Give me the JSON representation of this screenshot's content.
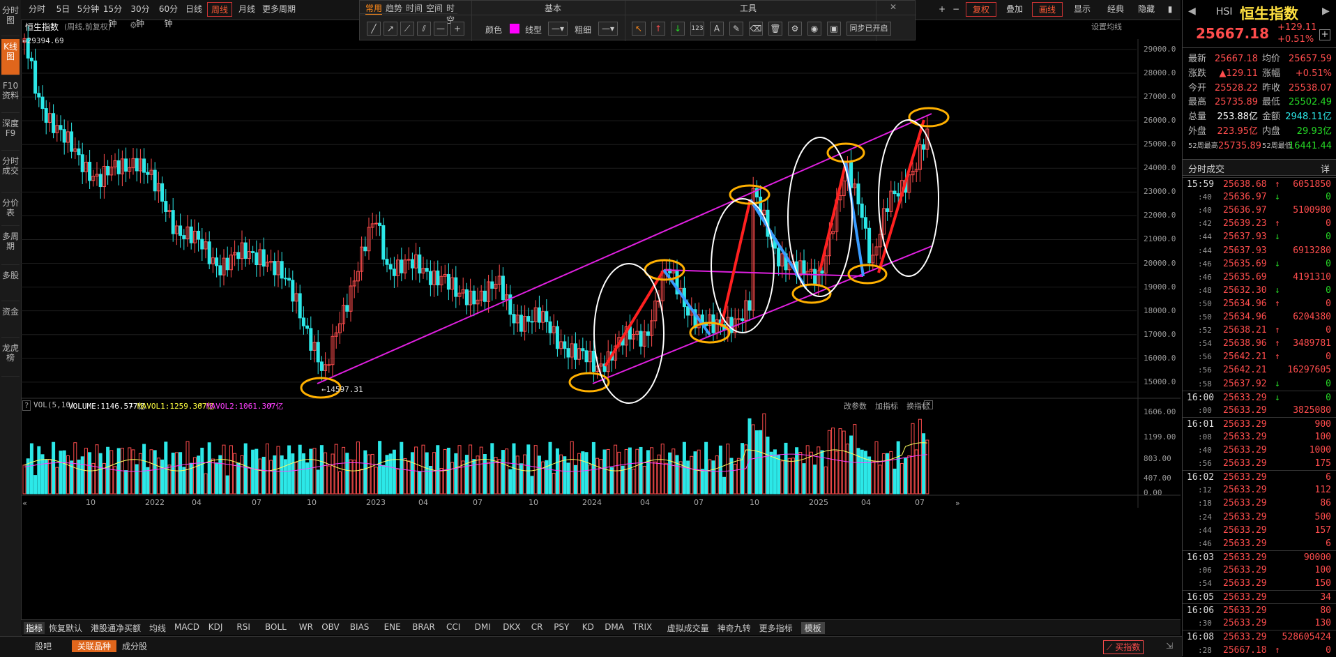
{
  "left_nav": [
    "分时图",
    "K线图",
    "F10资料",
    "深度F9",
    "分时成交",
    "分价表",
    "多周期",
    "多股",
    "资金",
    "龙虎榜"
  ],
  "toolbar": {
    "periods": [
      "分时",
      "5日",
      "5分钟",
      "15分钟",
      "30分钟",
      "60分钟",
      "日线",
      "周线",
      "月线",
      "更多周期"
    ],
    "selected_period": "周线",
    "right_buttons": [
      "复权",
      "叠加",
      "画线",
      "显示",
      "经典",
      "隐藏"
    ]
  },
  "draw_panel": {
    "tabs": [
      "常用",
      "趋势",
      "时间",
      "空间",
      "时空"
    ],
    "section_basic": "基本",
    "section_tools": "工具",
    "color_label": "颜色",
    "line_type_label": "线型",
    "thickness_label": "粗细",
    "sync_label": "同步已开启"
  },
  "chart_header": {
    "name": "恒生指数",
    "mode": "(周线,前复权)",
    "settings": "设置均线"
  },
  "price_axis": [
    "29000.0",
    "28000.0",
    "27000.0",
    "26000.0",
    "25000.0",
    "24000.0",
    "23000.0",
    "22000.0",
    "21000.0",
    "20000.0",
    "19000.0",
    "18000.0",
    "17000.0",
    "16000.0",
    "15000.0"
  ],
  "annotations": {
    "high": "29394.69",
    "low": "14597.31"
  },
  "volume_header": {
    "label": "VOL(5,10)",
    "volume": "VOLUME:1146.577亿",
    "ma1": "MAVOL1:1259.367亿",
    "ma2": "MAVOL2:1061.307亿",
    "actions": [
      "改参数",
      "加指标",
      "换指标"
    ]
  },
  "volume_axis": [
    "1606.00",
    "1199.00",
    "803.00",
    "407.00",
    "0.00"
  ],
  "time_axis": [
    "10",
    "2022",
    "04",
    "07",
    "10",
    "2023",
    "04",
    "07",
    "10",
    "2024",
    "04",
    "07",
    "10",
    "2025",
    "04",
    "07"
  ],
  "indicators": [
    "指标",
    "恢复默认",
    "港股通净买额",
    "均线",
    "MACD",
    "KDJ",
    "RSI",
    "BOLL",
    "WR",
    "OBV",
    "BIAS",
    "ENE",
    "BRAR",
    "CCI",
    "DMI",
    "DKX",
    "CR",
    "PSY",
    "KD",
    "DMA",
    "TRIX",
    "虚拟成交量",
    "神奇九转",
    "更多指标",
    "模板"
  ],
  "bottom_tabs": [
    "股吧",
    "关联品种",
    "成分股"
  ],
  "buy_index": "买指数",
  "quote": {
    "code": "HSI",
    "name": "恒生指数",
    "price": "25667.18",
    "change": "+129.11",
    "change_pct": "+0.51%",
    "rows": [
      [
        "最新",
        "25667.18",
        "均价",
        "25657.59"
      ],
      [
        "涨跌",
        "▲129.11",
        "涨幅",
        "+0.51%"
      ],
      [
        "今开",
        "25528.22",
        "昨收",
        "25538.07"
      ],
      [
        "最高",
        "25735.89",
        "最低",
        "25502.49"
      ],
      [
        "总量",
        "253.88亿",
        "金额",
        "2948.11亿"
      ],
      [
        "外盘",
        "223.95亿",
        "内盘",
        "29.93亿"
      ],
      [
        "52周最高",
        "25735.89",
        "52周最低",
        "16441.44"
      ]
    ]
  },
  "trades_title": "分时成交",
  "trades_detail": "详",
  "trades": [
    [
      "15:59",
      "25638.68",
      "↑",
      "6051850"
    ],
    [
      ":40",
      "25636.97",
      "↓",
      "0"
    ],
    [
      ":40",
      "25636.97",
      "",
      "5100980"
    ],
    [
      ":42",
      "25639.23",
      "↑",
      "0"
    ],
    [
      ":44",
      "25637.93",
      "↓",
      "0"
    ],
    [
      ":44",
      "25637.93",
      "",
      "6913280"
    ],
    [
      ":46",
      "25635.69",
      "↓",
      "0"
    ],
    [
      ":46",
      "25635.69",
      "",
      "4191310"
    ],
    [
      ":48",
      "25632.30",
      "↓",
      "0"
    ],
    [
      ":50",
      "25634.96",
      "↑",
      "0"
    ],
    [
      ":50",
      "25634.96",
      "",
      "6204380"
    ],
    [
      ":52",
      "25638.21",
      "↑",
      "0"
    ],
    [
      ":54",
      "25638.96",
      "↑",
      "3489781"
    ],
    [
      ":56",
      "25642.21",
      "↑",
      "0"
    ],
    [
      ":56",
      "25642.21",
      "",
      "16297605"
    ],
    [
      ":58",
      "25637.92",
      "↓",
      "0"
    ],
    [
      "16:00",
      "25633.29",
      "↓",
      "0"
    ],
    [
      ":00",
      "25633.29",
      "",
      "3825080"
    ],
    [
      "16:01",
      "25633.29",
      "",
      "900"
    ],
    [
      ":08",
      "25633.29",
      "",
      "100"
    ],
    [
      ":40",
      "25633.29",
      "",
      "1000"
    ],
    [
      ":56",
      "25633.29",
      "",
      "175"
    ],
    [
      "16:02",
      "25633.29",
      "",
      "6"
    ],
    [
      ":12",
      "25633.29",
      "",
      "112"
    ],
    [
      ":18",
      "25633.29",
      "",
      "86"
    ],
    [
      ":24",
      "25633.29",
      "",
      "500"
    ],
    [
      ":44",
      "25633.29",
      "",
      "157"
    ],
    [
      ":46",
      "25633.29",
      "",
      "6"
    ],
    [
      "16:03",
      "25633.29",
      "",
      "90000"
    ],
    [
      ":06",
      "25633.29",
      "",
      "100"
    ],
    [
      ":54",
      "25633.29",
      "",
      "150"
    ],
    [
      "16:05",
      "25633.29",
      "",
      "34"
    ],
    [
      "16:06",
      "25633.29",
      "",
      "80"
    ],
    [
      ":30",
      "25633.29",
      "",
      "130"
    ],
    [
      "16:08",
      "25633.29",
      "",
      "528605424"
    ],
    [
      ":28",
      "25667.18",
      "↑",
      "0"
    ]
  ]
}
